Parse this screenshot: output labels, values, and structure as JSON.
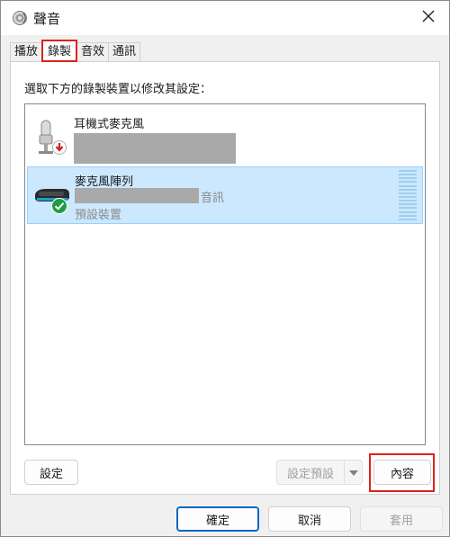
{
  "window": {
    "title": "聲音",
    "icon": "speaker-icon",
    "close_icon": "close-icon"
  },
  "tabs": [
    {
      "label": "播放",
      "active": false
    },
    {
      "label": "錄製",
      "active": true
    },
    {
      "label": "音效",
      "active": false
    },
    {
      "label": "通訊",
      "active": false
    }
  ],
  "instruction": "選取下方的錄製裝置以修改其設定：",
  "devices": [
    {
      "name": "耳機式麥克風",
      "icon": "headset-microphone-icon",
      "status_icon": "unplugged-arrow-icon",
      "detail_redacted": true
    },
    {
      "name": "麥克風陣列",
      "icon": "microphone-array-icon",
      "status_icon": "default-check-icon",
      "detail_suffix": "音訊",
      "status": "預設裝置",
      "selected": true
    }
  ],
  "buttons": {
    "configure": "設定",
    "set_default": "設定預設",
    "properties": "內容",
    "ok": "確定",
    "cancel": "取消",
    "apply": "套用"
  },
  "colors": {
    "highlight": "#e0211b",
    "selection_bg": "#cce8ff",
    "selection_border": "#99d1ff",
    "primary_border": "#0067c0",
    "check_green": "#1e9e43",
    "arrow_red": "#d32020"
  }
}
